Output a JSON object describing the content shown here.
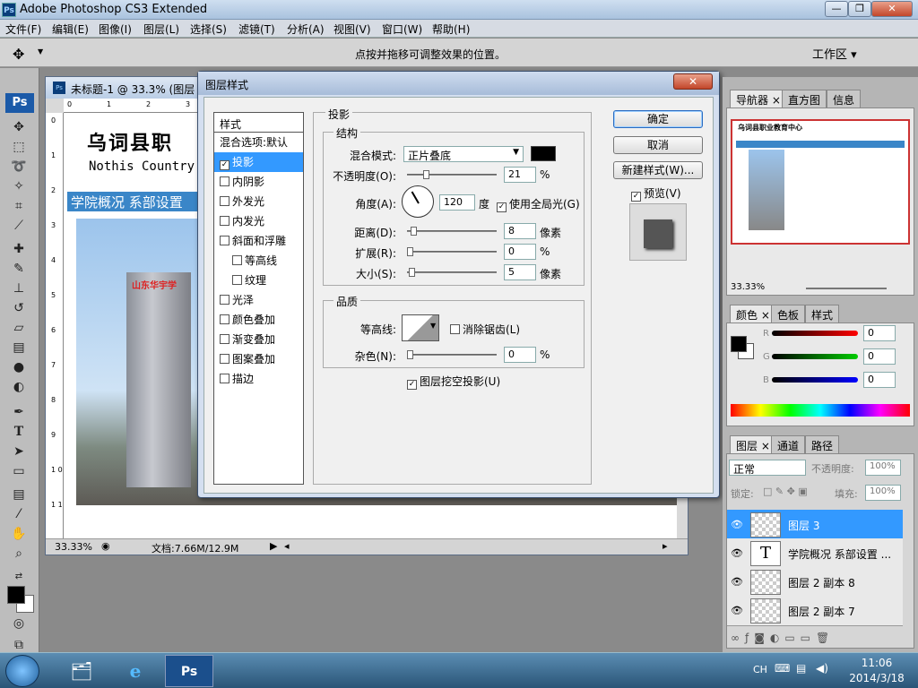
{
  "app": {
    "title": "Adobe Photoshop CS3 Extended",
    "badge": "Ps"
  },
  "window_controls": {
    "minimize": "—",
    "restore": "❐",
    "close": "✕"
  },
  "menu": [
    "文件(F)",
    "编辑(E)",
    "图像(I)",
    "图层(L)",
    "选择(S)",
    "滤镜(T)",
    "分析(A)",
    "视图(V)",
    "窗口(W)",
    "帮助(H)"
  ],
  "options_bar": {
    "tool_icon": "move-icon",
    "hint": "点按并拖移可调整效果的位置。",
    "workspace": "工作区 ▾"
  },
  "toolbox": {
    "badge": "Ps"
  },
  "document": {
    "title": "未标题-1 @ 33.3% (图层",
    "ruler_top": [
      "0",
      "1",
      "2",
      "3"
    ],
    "ruler_left": [
      "0",
      "1",
      "2",
      "3",
      "4",
      "5",
      "6",
      "7",
      "8",
      "9",
      "1 0",
      "1 1"
    ],
    "headline": "乌词县职",
    "english": "Nothis Country",
    "nav": "学院概况  系部设置",
    "building_sign": "山东华宇学",
    "zoom": "33.33%",
    "doc_size": "文档:7.66M/12.9M"
  },
  "dialog": {
    "title": "图层样式",
    "close": "✕",
    "styles_header": "样式",
    "styles": [
      {
        "label": "混合选项:默认",
        "checkbox": false,
        "checked": false,
        "sub": false
      },
      {
        "label": "投影",
        "checkbox": true,
        "checked": true,
        "sub": false,
        "selected": true
      },
      {
        "label": "内阴影",
        "checkbox": true,
        "checked": false,
        "sub": false
      },
      {
        "label": "外发光",
        "checkbox": true,
        "checked": false,
        "sub": false
      },
      {
        "label": "内发光",
        "checkbox": true,
        "checked": false,
        "sub": false
      },
      {
        "label": "斜面和浮雕",
        "checkbox": true,
        "checked": false,
        "sub": false
      },
      {
        "label": "等高线",
        "checkbox": true,
        "checked": false,
        "sub": true
      },
      {
        "label": "纹理",
        "checkbox": true,
        "checked": false,
        "sub": true
      },
      {
        "label": "光泽",
        "checkbox": true,
        "checked": false,
        "sub": false
      },
      {
        "label": "颜色叠加",
        "checkbox": true,
        "checked": false,
        "sub": false
      },
      {
        "label": "渐变叠加",
        "checkbox": true,
        "checked": false,
        "sub": false
      },
      {
        "label": "图案叠加",
        "checkbox": true,
        "checked": false,
        "sub": false
      },
      {
        "label": "描边",
        "checkbox": true,
        "checked": false,
        "sub": false
      }
    ],
    "section_title": "投影",
    "structure": {
      "group": "结构",
      "blend_label": "混合模式:",
      "blend_value": "正片叠底",
      "blend_color": "#000000",
      "opacity_label": "不透明度(O):",
      "opacity_value": "21",
      "percent": "%",
      "angle_label": "角度(A):",
      "angle_value": "120",
      "angle_unit": "度",
      "global_light": "使用全局光(G)",
      "distance_label": "距离(D):",
      "distance_value": "8",
      "spread_label": "扩展(R):",
      "spread_value": "0",
      "size_label": "大小(S):",
      "size_value": "5",
      "pixels": "像素"
    },
    "quality": {
      "group": "品质",
      "contour_label": "等高线:",
      "antialias": "消除锯齿(L)",
      "noise_label": "杂色(N):",
      "noise_value": "0"
    },
    "knockout": "图层挖空投影(U)",
    "buttons": {
      "ok": "确定",
      "cancel": "取消",
      "new_style": "新建样式(W)...",
      "preview": "预览(V)"
    }
  },
  "navigator": {
    "tabs": [
      "导航器",
      "直方图",
      "信息"
    ],
    "thumb_title": "乌词县职业教育中心",
    "zoom": "33.33%"
  },
  "color_panel": {
    "tabs": [
      "颜色",
      "色板",
      "样式"
    ],
    "channels": [
      {
        "label": "R",
        "value": "0"
      },
      {
        "label": "G",
        "value": "0"
      },
      {
        "label": "B",
        "value": "0"
      }
    ]
  },
  "layers_panel": {
    "tabs": [
      "图层",
      "通道",
      "路径"
    ],
    "blend": "正常",
    "opacity_label": "不透明度:",
    "opacity": "100%",
    "lock_label": "锁定:",
    "fill_label": "填充:",
    "fill": "100%",
    "layers": [
      {
        "name": "图层 3",
        "selected": true,
        "thumb": "image"
      },
      {
        "name": "学院概况  系部设置 ...",
        "selected": false,
        "thumb": "T"
      },
      {
        "name": "图层 2 副本 8",
        "selected": false,
        "thumb": "image"
      },
      {
        "name": "图层 2 副本 7",
        "selected": false,
        "thumb": "image"
      }
    ]
  },
  "taskbar": {
    "lang": "CH",
    "time": "11:06",
    "date": "2014/3/18"
  }
}
